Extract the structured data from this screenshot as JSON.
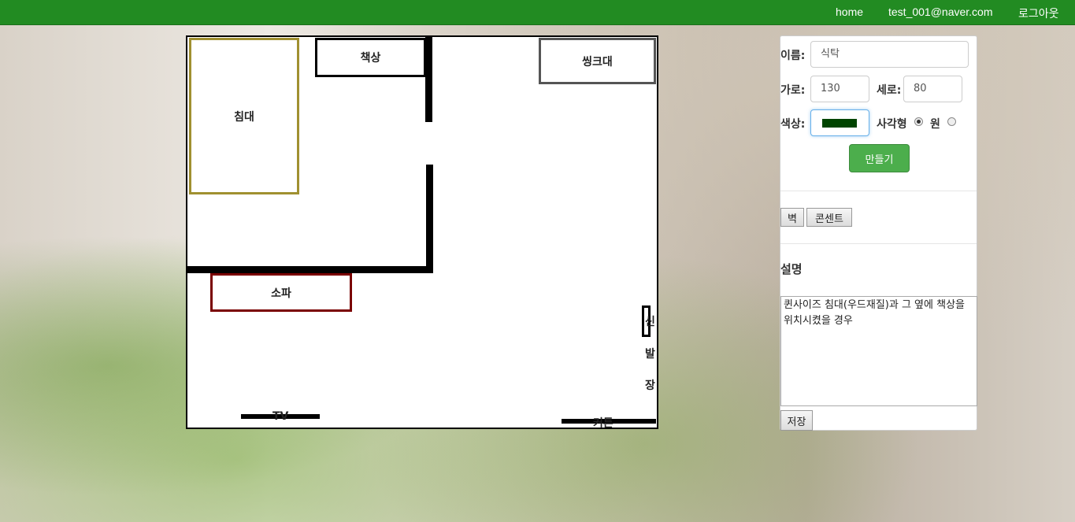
{
  "topbar": {
    "home": "home",
    "user": "test_001@naver.com",
    "logout": "로그아웃",
    "color": "#228b22"
  },
  "floorplan": {
    "items": {
      "bed": "침대",
      "desk": "책상",
      "sink": "씽크대",
      "sofa": "소파",
      "tv": "TV",
      "curtain": "커튼"
    },
    "shoe_closet_chars": [
      "신",
      "발",
      "장"
    ]
  },
  "form": {
    "name_label": "이름:",
    "name_value": "식탁",
    "width_label": "가로:",
    "width_value": "130",
    "height_label": "세로:",
    "height_value": "80",
    "color_label": "색상:",
    "color_value": "#004400",
    "shape_rect_label": "사각형",
    "shape_circle_label": "원",
    "selected_shape": "사각형",
    "create_button": "만들기"
  },
  "tools": {
    "wall_button": "벽",
    "outlet_button": "콘센트"
  },
  "description": {
    "heading": "설명",
    "text": "퀸사이즈 침대(우드재질)과 그 옆에 책상을 위치시켰을 경우",
    "save_button": "저장"
  }
}
